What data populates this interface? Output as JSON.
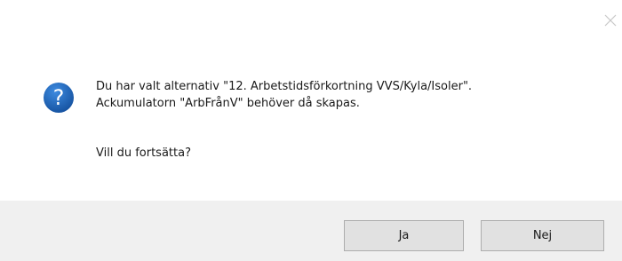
{
  "dialog": {
    "message": {
      "line1": "Du har valt alternativ \"12. Arbetstidsförkortning VVS/Kyla/Isoler\".",
      "line2": "Ackumulatorn \"ArbFrånV\" behöver då skapas.",
      "line3": "Vill du fortsätta?"
    },
    "icon": "question-icon",
    "close_icon": "close-icon",
    "buttons": {
      "yes_label": "Ja",
      "no_label": "Nej"
    },
    "colors": {
      "icon_blue": "#1c5fb4",
      "footer_bg": "#f0f0f0",
      "button_bg": "#e1e1e1",
      "button_border": "#adadad"
    }
  }
}
